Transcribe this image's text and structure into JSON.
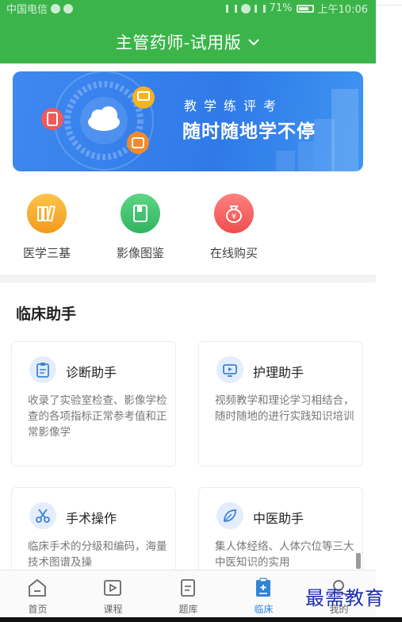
{
  "statusbar": {
    "carrier": "中国电信",
    "battery": "71%",
    "time": "上午10:06"
  },
  "header": {
    "title": "主管药师-试用版"
  },
  "banner": {
    "line1": "教学练评考",
    "line2": "随时随地学不停"
  },
  "quick": [
    {
      "label": "医学三基",
      "color": "#f5a623"
    },
    {
      "label": "影像图鉴",
      "color": "#3fbf6a"
    },
    {
      "label": "在线购买",
      "color": "#ef5a5a"
    }
  ],
  "section": {
    "title": "临床助手"
  },
  "cards": [
    {
      "title": "诊断助手",
      "desc": "收录了实验室检查、影像学检查的各项指标正常参考值和正常影像学"
    },
    {
      "title": "护理助手",
      "desc": "视频教学和理论学习相结合，随时随地的进行实践知识培训"
    },
    {
      "title": "手术操作",
      "desc": "临床手术的分级和编码，海量技术图谱及操"
    },
    {
      "title": "中医助手",
      "desc": "集人体经络、人体穴位等三大中医知识的实用"
    }
  ],
  "tabs": [
    {
      "label": "首页",
      "active": false
    },
    {
      "label": "课程",
      "active": false
    },
    {
      "label": "题库",
      "active": false
    },
    {
      "label": "临床",
      "active": true
    },
    {
      "label": "我的",
      "active": false
    }
  ],
  "watermark": "最需教育",
  "colors": {
    "brand_green": "#3bb54a",
    "accent_blue": "#2e85d8"
  }
}
